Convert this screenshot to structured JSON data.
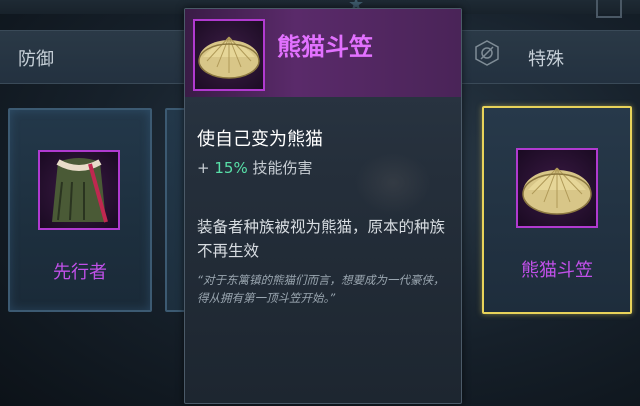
{
  "categories": {
    "left": "防御",
    "right": "特殊"
  },
  "slots": [
    {
      "name": "先行者",
      "icon": "cloak-icon"
    },
    {
      "name": "熊猫斗笠",
      "icon": "straw-hat-icon"
    }
  ],
  "tooltip": {
    "title": "熊猫斗笠",
    "subtitle": "使自己变为熊猫",
    "bonus_prefix": "+",
    "bonus_value": "15%",
    "bonus_label": "技能伤害",
    "description": "装备者种族被视为熊猫，原本的种族不再生效",
    "quote": "“对于东篱镇的熊猫们而言，想要成为一代豪侠，得从拥有第一顶斗笠开始。”"
  },
  "colors": {
    "item_name": "#c050e8",
    "title": "#e271ff",
    "bonus": "#58e0a8",
    "selected_border": "#e8d35a"
  }
}
